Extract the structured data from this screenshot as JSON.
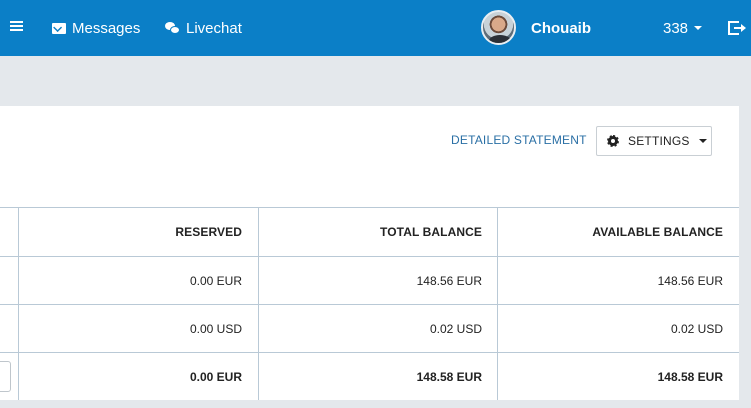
{
  "nav": {
    "messages_label": "Messages",
    "livechat_label": "Livechat",
    "user_name": "Chouaib",
    "counter": "338"
  },
  "actions": {
    "detailed_statement": "DETAILED STATEMENT",
    "settings_label": "SETTINGS"
  },
  "table": {
    "headers": [
      "RESERVED",
      "TOTAL BALANCE",
      "AVAILABLE BALANCE"
    ],
    "rows": [
      [
        "0.00 EUR",
        "148.56 EUR",
        "148.56 EUR"
      ],
      [
        "0.00 USD",
        "0.02 USD",
        "0.02 USD"
      ]
    ],
    "total": [
      "0.00 EUR",
      "148.58 EUR",
      "148.58 EUR"
    ]
  },
  "colors": {
    "topbar": "#0b7fc7",
    "link": "#2a6fa5",
    "page_background": "#e4e8ec"
  },
  "icons": [
    "menu-icon",
    "envelope-icon",
    "chat-icon",
    "avatar",
    "chevron-down-icon",
    "logout-icon",
    "gear-icon"
  ]
}
